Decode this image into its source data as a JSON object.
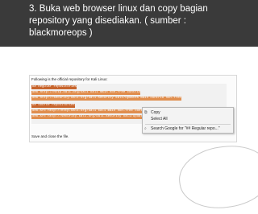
{
  "slide": {
    "title": "3. Buka web browser linux  dan copy bagian repository yang disediakan. ( sumber : blackmoreops )"
  },
  "screenshot": {
    "intro_text": "Following is the official repository for Kali Linux:",
    "repo_lines": [
      {
        "text": "## Regular repositories",
        "kind": "comment"
      },
      {
        "text": "deb http://http.kali.org/kali kali main non-free contrib",
        "kind": "source"
      },
      {
        "text": "deb http://security.kali.org/kali-security kali/updates main contrib non-free",
        "kind": "source"
      },
      {
        "text": "## Source repositories",
        "kind": "comment"
      },
      {
        "text": "deb-src http://http.kali.org/kali kali main non-free contrib",
        "kind": "source"
      },
      {
        "text": "deb-src http://security.kali.org/kali-security kali/updates main contrib non-free",
        "kind": "source"
      }
    ],
    "save_text": "Save and close the file."
  },
  "context_menu": {
    "copy": "Copy",
    "select_all": "Select All",
    "search": "Search Google for \"## Regular repo...\""
  },
  "colors": {
    "header": "#3a3a3a",
    "highlight": "#e08e4e",
    "highlight_comment": "#c7652d",
    "menu_bg": "#f3f3f3"
  }
}
